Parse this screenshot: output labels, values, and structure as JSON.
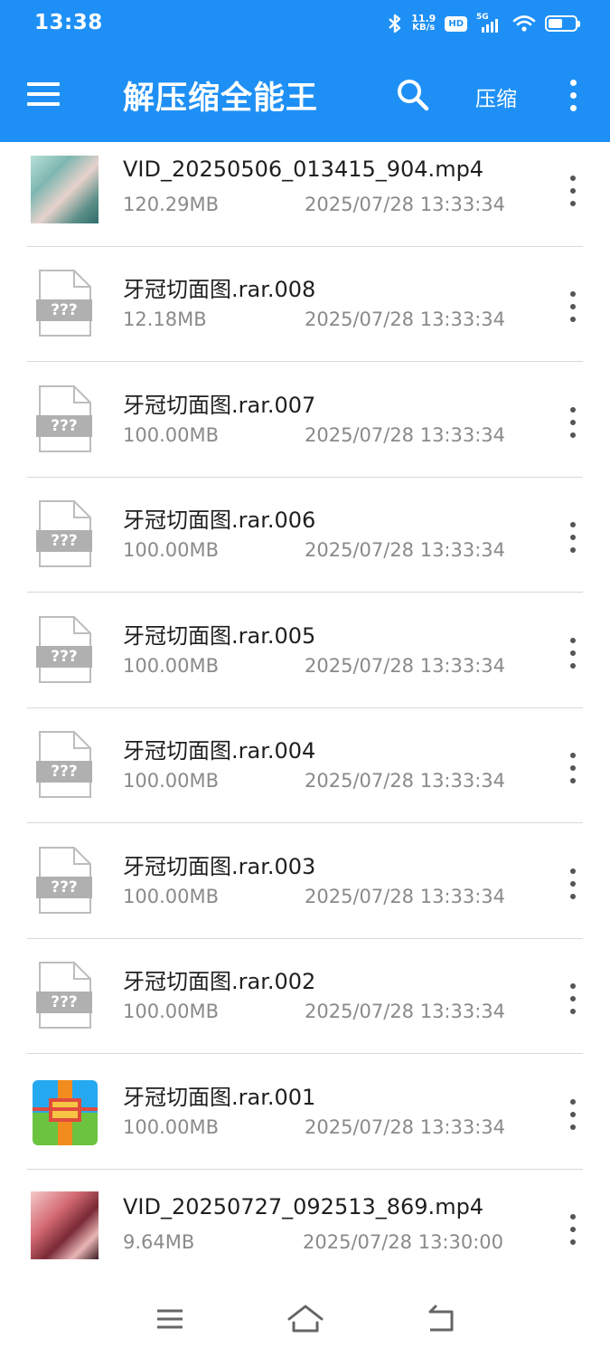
{
  "status_bar": {
    "time": "13:38",
    "net_speed_value": "11.9",
    "net_speed_unit": "KB/s",
    "hd_label": "HD",
    "network_label": "5G",
    "battery_level": 0.55,
    "icons": [
      "bluetooth-icon",
      "hd-icon",
      "5g-signal-icon",
      "wifi-icon",
      "battery-icon"
    ]
  },
  "app_bar": {
    "title": "解压缩全能王",
    "compress_label": "压缩",
    "icons": [
      "menu-icon",
      "search-icon",
      "more-vertical-icon"
    ],
    "background_color": "#1e90f5"
  },
  "files": [
    {
      "name": "VID_20250506_013415_904.mp4",
      "size": "120.29MB",
      "date": "2025/07/28 13:33:34",
      "icon": "video-thumbnail"
    },
    {
      "name": "牙冠切面图.rar.008",
      "size": "12.18MB",
      "date": "2025/07/28 13:33:34",
      "icon": "unknown-file-icon",
      "icon_text": "???"
    },
    {
      "name": "牙冠切面图.rar.007",
      "size": "100.00MB",
      "date": "2025/07/28 13:33:34",
      "icon": "unknown-file-icon",
      "icon_text": "???"
    },
    {
      "name": "牙冠切面图.rar.006",
      "size": "100.00MB",
      "date": "2025/07/28 13:33:34",
      "icon": "unknown-file-icon",
      "icon_text": "???"
    },
    {
      "name": "牙冠切面图.rar.005",
      "size": "100.00MB",
      "date": "2025/07/28 13:33:34",
      "icon": "unknown-file-icon",
      "icon_text": "???"
    },
    {
      "name": "牙冠切面图.rar.004",
      "size": "100.00MB",
      "date": "2025/07/28 13:33:34",
      "icon": "unknown-file-icon",
      "icon_text": "???"
    },
    {
      "name": "牙冠切面图.rar.003",
      "size": "100.00MB",
      "date": "2025/07/28 13:33:34",
      "icon": "unknown-file-icon",
      "icon_text": "???"
    },
    {
      "name": "牙冠切面图.rar.002",
      "size": "100.00MB",
      "date": "2025/07/28 13:33:34",
      "icon": "unknown-file-icon",
      "icon_text": "???"
    },
    {
      "name": "牙冠切面图.rar.001",
      "size": "100.00MB",
      "date": "2025/07/28 13:33:34",
      "icon": "winrar-archive-icon"
    },
    {
      "name": "VID_20250727_092513_869.mp4",
      "size": "9.64MB",
      "date": "2025/07/28 13:30:00",
      "icon": "video-thumbnail"
    }
  ],
  "nav_bar": {
    "icons": [
      "recents-icon",
      "home-icon",
      "back-icon"
    ]
  }
}
